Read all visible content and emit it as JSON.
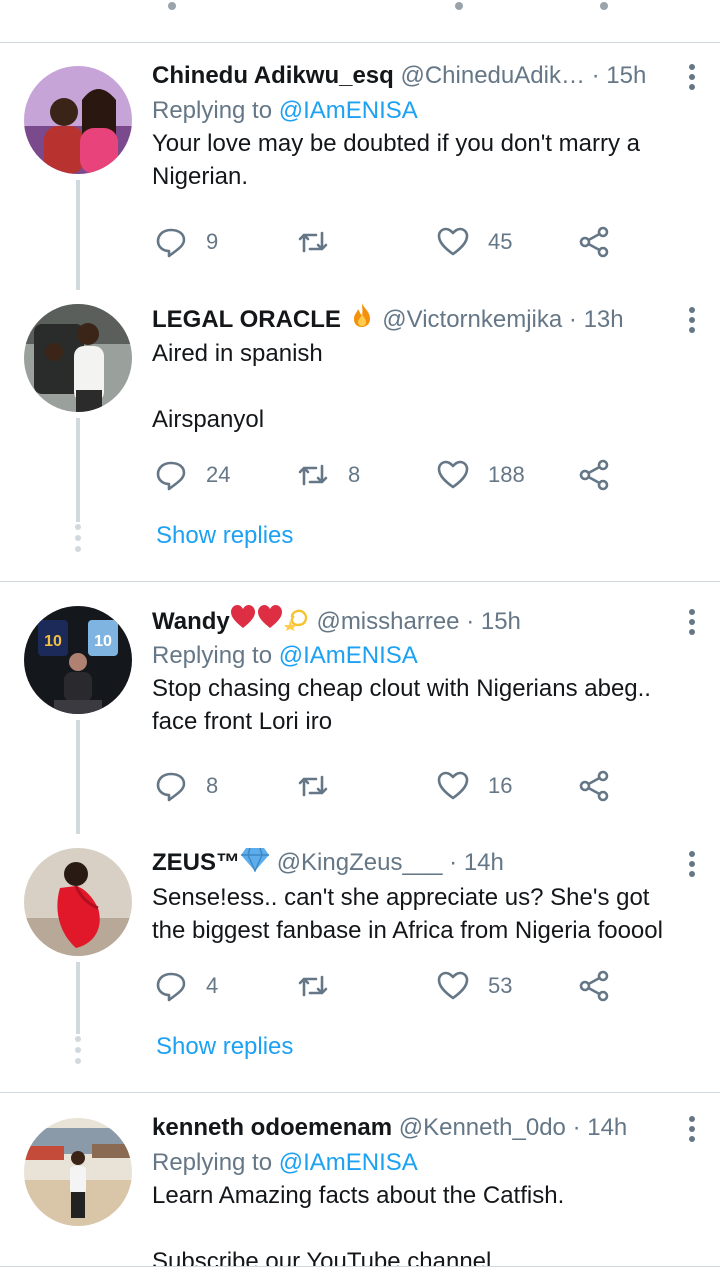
{
  "tweets": [
    {
      "name": "Chinedu Adikwu_esq",
      "handle": "@ChineduAdik…",
      "time": "15h",
      "replying_prefix": "Replying to",
      "replying_to": "@IAmENISA",
      "body": [
        "Your love may be doubted if you don't marry a",
        "Nigerian."
      ],
      "replies": "9",
      "retweets": "",
      "likes": "45"
    },
    {
      "name": "LEGAL ORACLE",
      "name_emoji": "fire-emoji",
      "handle": "@Victornkemjika",
      "time": "13h",
      "body": [
        "Aired in spanish",
        "",
        "Airspanyol"
      ],
      "replies": "24",
      "retweets": "8",
      "likes": "188"
    },
    {
      "name": "Wandy",
      "name_emoji": "hearts-and-dizzy-emoji",
      "handle": "@missharree",
      "time": "15h",
      "replying_prefix": "Replying to",
      "replying_to": "@IAmENISA",
      "body": [
        "Stop chasing cheap clout with Nigerians abeg..",
        "face front Lori iro"
      ],
      "replies": "8",
      "retweets": "",
      "likes": "16"
    },
    {
      "name": "ZEUS™",
      "name_emoji": "gem-emoji",
      "handle": "@KingZeus___",
      "time": "14h",
      "body": [
        "Sense!ess.. can't she appreciate us? She's got",
        "the biggest fanbase in Africa from Nigeria fooool"
      ],
      "replies": "4",
      "retweets": "",
      "likes": "53"
    },
    {
      "name": "kenneth odoemenam",
      "handle": "@Kenneth_0do",
      "time": "14h",
      "replying_prefix": "Replying to",
      "replying_to": "@IAmENISA",
      "body": [
        "Learn Amazing facts about the Catfish.",
        "",
        "Subscribe our YouTube channel"
      ]
    }
  ],
  "show_replies_label": "Show replies",
  "separator": "·",
  "colors": {
    "link": "#1da1f2",
    "muted": "#657786",
    "text": "#14171a",
    "divider": "#cfd9de"
  }
}
